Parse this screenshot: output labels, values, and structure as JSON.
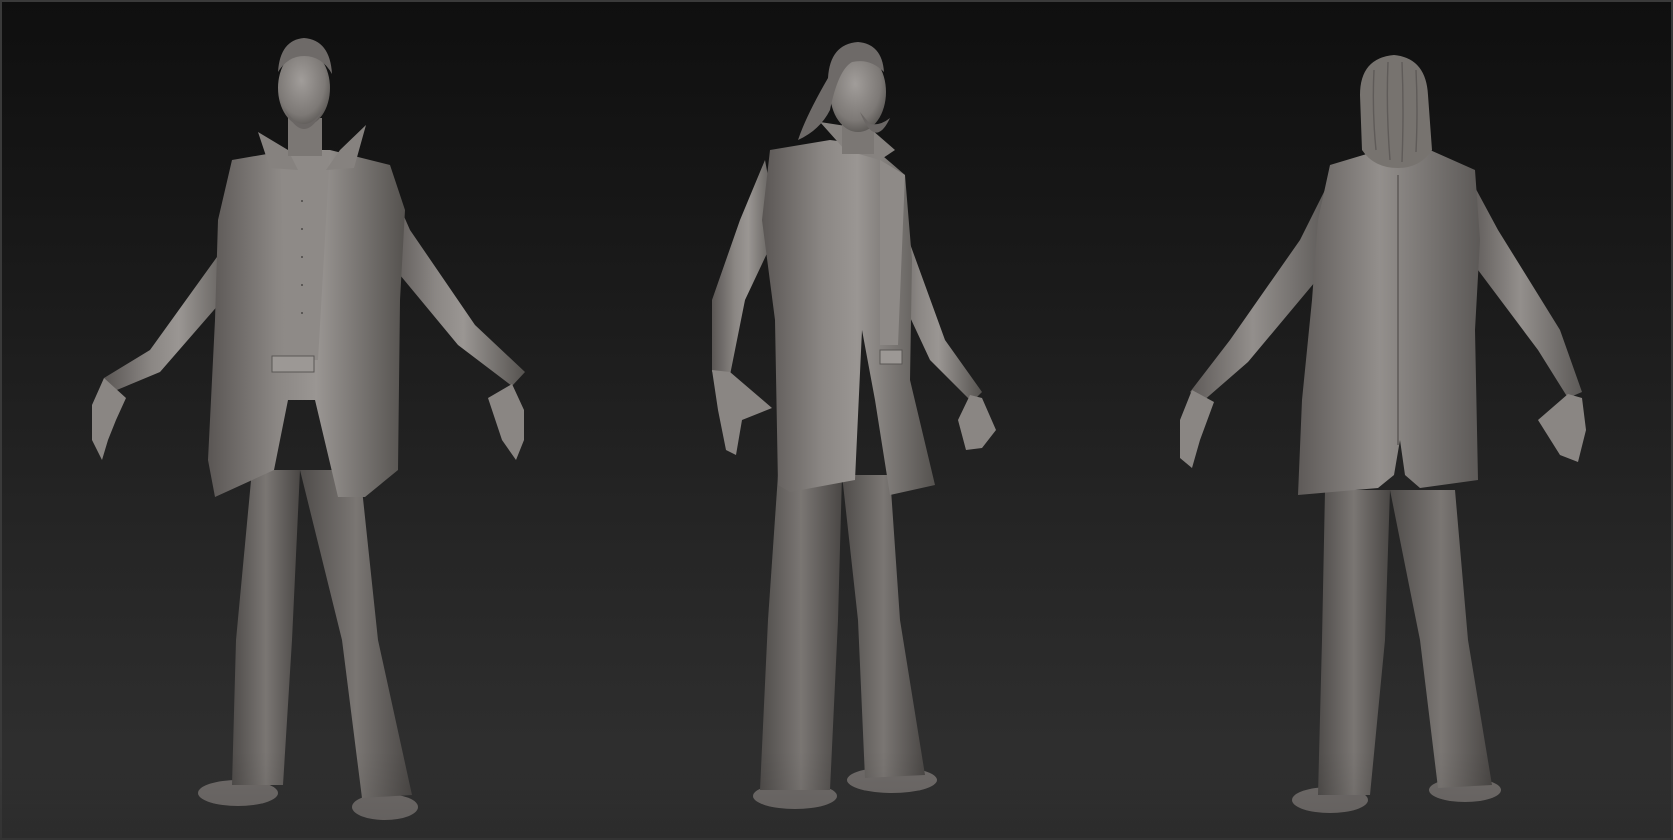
{
  "scene": {
    "background_top": "#0f0f0f",
    "background_bottom": "#323232",
    "material_base": "#7f7b79",
    "material_light": "#9a9693",
    "material_shadow": "#4b4846",
    "views": [
      {
        "name": "front",
        "icon": "front-view-figure"
      },
      {
        "name": "three-quarter",
        "icon": "three-quarter-view-figure"
      },
      {
        "name": "back",
        "icon": "back-view-figure"
      }
    ]
  }
}
